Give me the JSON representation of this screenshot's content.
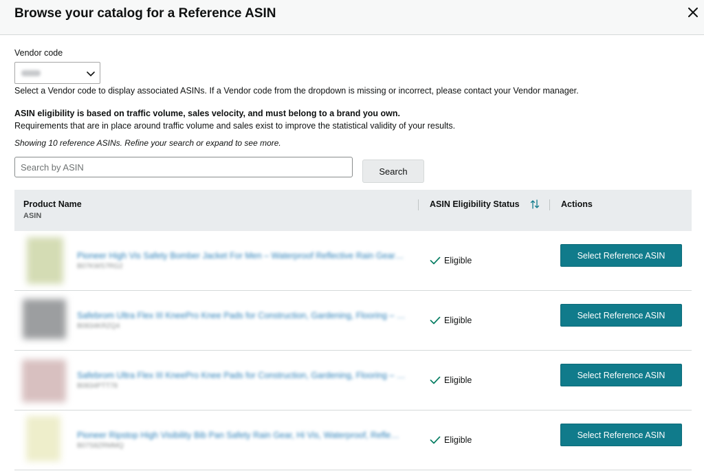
{
  "modal": {
    "title": "Browse your catalog for a Reference ASIN"
  },
  "vendor": {
    "label": "Vendor code",
    "help_text": "Select a Vendor code to display associated ASINs. If a Vendor code from the dropdown is missing or incorrect, please contact your Vendor manager."
  },
  "eligibility": {
    "heading": "ASIN eligibility is based on traffic volume, sales velocity, and must belong to a brand you own.",
    "description": "Requirements that are in place around traffic volume and sales exist to improve the statistical validity of your results."
  },
  "results_note": "Showing 10 reference ASINs. Refine your search or expand to see more.",
  "search": {
    "placeholder": "Search by ASIN",
    "button_label": "Search"
  },
  "table": {
    "columns": {
      "product_name": "Product Name",
      "asin": "ASIN",
      "eligibility_status": "ASIN Eligibility Status",
      "actions": "Actions"
    },
    "rows": [
      {
        "product_name": "Pioneer High Vis Safety Bomber Jacket For Men – Waterproof Reflective Rain Gear…",
        "asin": "B07KWS7RG2",
        "status": "Eligible",
        "action_label": "Select Reference ASIN"
      },
      {
        "product_name": "Safebrom Ultra Flex III KneePro Knee Pads for Construction, Gardening, Flooring – …",
        "asin": "B0834KRZQ4",
        "status": "Eligible",
        "action_label": "Select Reference ASIN"
      },
      {
        "product_name": "Safebrom Ultra Flex III KneePro Knee Pads for Construction, Gardening, Flooring – …",
        "asin": "B0834PTT78",
        "status": "Eligible",
        "action_label": "Select Reference ASIN"
      },
      {
        "product_name": "Pioneer Ripstop High Visibility Bib Pan Safety Rain Gear, Hi Vis, Waterproof, Refle…",
        "asin": "B07S8ZRMMQ",
        "status": "Eligible",
        "action_label": "Select Reference ASIN"
      }
    ]
  },
  "colors": {
    "primary_button": "#107b8b",
    "table_header_bg": "#e9ecee",
    "status_check": "#067d62"
  },
  "icons": {
    "close": "close-icon",
    "dropdown": "chevron-down-icon",
    "sort": "sort-arrows-icon",
    "status": "check-icon"
  }
}
